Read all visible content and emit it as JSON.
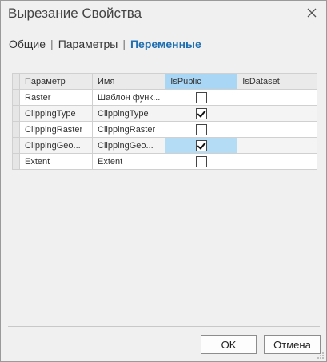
{
  "dialog": {
    "title": "Вырезание Свойства",
    "close_icon": "close-icon"
  },
  "tabs": [
    {
      "label": "Общие",
      "active": false
    },
    {
      "label": "Параметры",
      "active": false
    },
    {
      "label": "Переменные",
      "active": true
    }
  ],
  "tab_separator": "|",
  "table": {
    "columns": [
      "Параметр",
      "Имя",
      "IsPublic",
      "IsDataset"
    ],
    "rows": [
      {
        "param": "Raster",
        "name": "Шаблон функ...",
        "is_public": false,
        "is_dataset": ""
      },
      {
        "param": "ClippingType",
        "name": "ClippingType",
        "is_public": true,
        "is_dataset": ""
      },
      {
        "param": "ClippingRaster",
        "name": "ClippingRaster",
        "is_public": false,
        "is_dataset": ""
      },
      {
        "param": "ClippingGeo...",
        "name": "ClippingGeo...",
        "is_public": true,
        "is_dataset": ""
      },
      {
        "param": "Extent",
        "name": "Extent",
        "is_public": false,
        "is_dataset": ""
      }
    ]
  },
  "buttons": {
    "ok": "OK",
    "cancel": "Отмена"
  },
  "colors": {
    "accent": "#1f6fb2",
    "header_highlight": "#a9d6f5",
    "selection": "#b5dcf5"
  }
}
